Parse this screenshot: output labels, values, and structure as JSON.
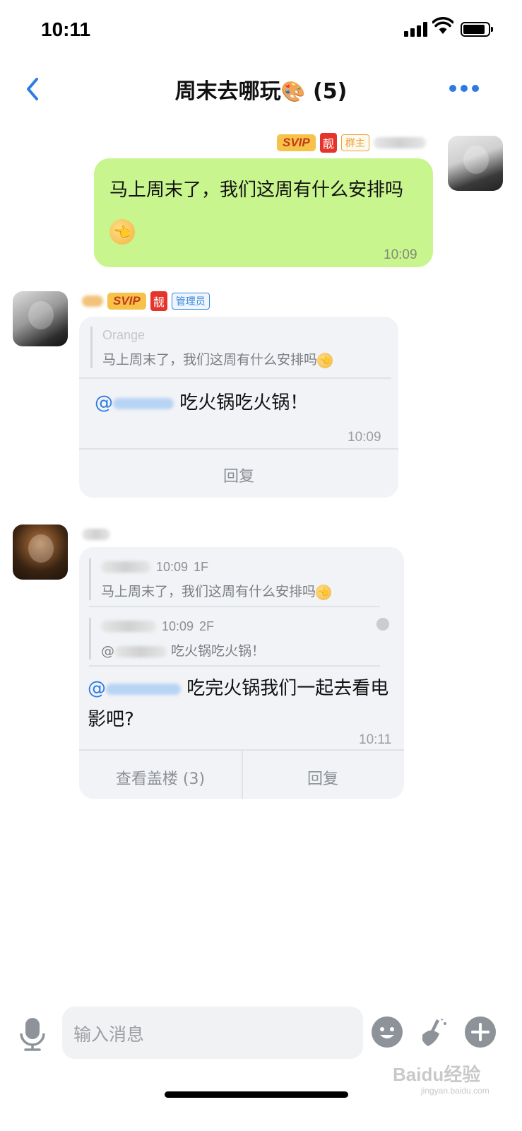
{
  "status_bar": {
    "time": "10:11"
  },
  "nav": {
    "title": "周末去哪玩",
    "member_count": "(5)",
    "title_icon": "palette-icon"
  },
  "messages": {
    "self": {
      "badges": {
        "svip": "SVIP",
        "liang": "靓",
        "owner": "群主"
      },
      "text": "马上周末了，我们这周有什么安排吗",
      "time": "10:09"
    },
    "admin": {
      "badges": {
        "svip": "SVIP",
        "liang": "靓",
        "admin": "管理员"
      },
      "quote_author": "Orange",
      "quote_text": "马上周末了，我们这周有什么安排吗",
      "mention": "@",
      "text": "吃火锅吃火锅！",
      "time": "10:09",
      "reply_label": "回复"
    },
    "third": {
      "quote1": {
        "time": "10:09",
        "floor": "1F",
        "text": "马上周末了，我们这周有什么安排吗"
      },
      "quote2": {
        "time": "10:09",
        "floor": "2F",
        "mention": "@",
        "text": "吃火锅吃火锅！"
      },
      "mention": "@",
      "text": "吃完火锅我们一起去看电影吧?",
      "time": "10:11",
      "thread_label": "查看盖楼 (3)",
      "reply_label": "回复"
    }
  },
  "input_bar": {
    "placeholder": "输入消息"
  },
  "watermark": {
    "brand": "Baidu经验",
    "url": "jingyan.baidu.com"
  },
  "colors": {
    "accent": "#2c7be5",
    "self_bubble": "#c8f58e",
    "card_bg": "#f1f3f6"
  }
}
